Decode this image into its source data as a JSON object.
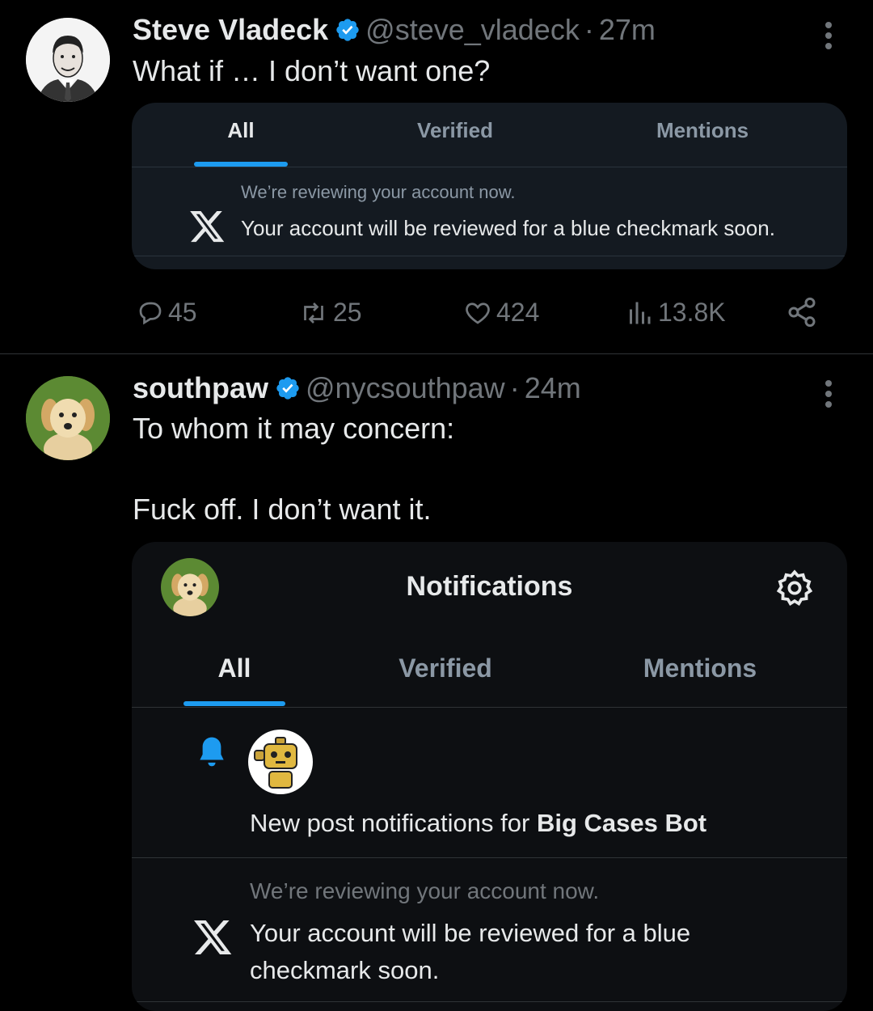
{
  "post1": {
    "author_name": "Steve Vladeck",
    "handle": "@steve_vladeck",
    "separator": "·",
    "time": "27m",
    "text": "What if … I don’t want one?",
    "card": {
      "tabs": [
        "All",
        "Verified",
        "Mentions"
      ],
      "review_heading": "We’re reviewing your account now.",
      "review_message": "Your account will be reviewed for a blue checkmark soon."
    },
    "stats": {
      "replies": "45",
      "reposts": "25",
      "likes": "424",
      "views": "13.8K"
    }
  },
  "post2": {
    "author_name": "southpaw",
    "handle": "@nycsouthpaw",
    "separator": "·",
    "time": "24m",
    "text_line1": "To whom it may concern:",
    "text_line2": "Fuck off. I don’t want it.",
    "card": {
      "title": "Notifications",
      "tabs": [
        "All",
        "Verified",
        "Mentions"
      ],
      "notification_prefix": "New post notifications for ",
      "notification_account": "Big Cases Bot",
      "review_heading": "We’re reviewing your account now.",
      "review_message_line1": "Your account will be reviewed for a blue",
      "review_message_line2": "checkmark soon."
    }
  },
  "colors": {
    "accent": "#1d9bf0",
    "secondary_text": "#71767b",
    "card_bg": "#141a21",
    "background": "#000000"
  },
  "icons": [
    "verified-badge-icon",
    "more-icon",
    "x-logo-icon",
    "reply-icon",
    "repost-icon",
    "like-icon",
    "views-icon",
    "share-icon",
    "settings-gear-icon",
    "bell-icon"
  ]
}
